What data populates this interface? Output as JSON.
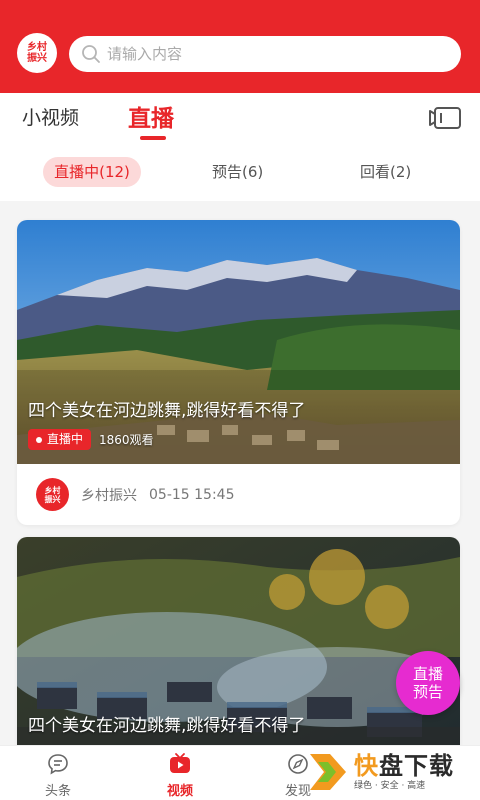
{
  "header": {
    "logo_line1": "乡村",
    "logo_line2": "振兴",
    "search_placeholder": "请输入内容",
    "brand_color": "#e8262a"
  },
  "tabs": {
    "short_video": "小视频",
    "live": "直播",
    "camera_icon": "video-camera-icon"
  },
  "subtabs": {
    "live_now": "直播中(12)",
    "preview": "预告(6)",
    "replay": "回看(2)"
  },
  "feed": [
    {
      "title": "四个美女在河边跳舞,跳得好看不得了",
      "badge": "直播中",
      "viewers": "1860观看",
      "author": "乡村振兴",
      "time": "05-15 15:45"
    },
    {
      "title": "四个美女在河边跳舞,跳得好看不得了"
    }
  ],
  "float_button": {
    "line1": "直播",
    "line2": "预告",
    "color": "#e62bd0"
  },
  "bottom_nav": {
    "news": "头条",
    "video": "视频",
    "discover": "发现"
  },
  "watermark": {
    "main_a": "快",
    "main_b": "盘下载",
    "sub": "绿色 · 安全 · 高速"
  }
}
